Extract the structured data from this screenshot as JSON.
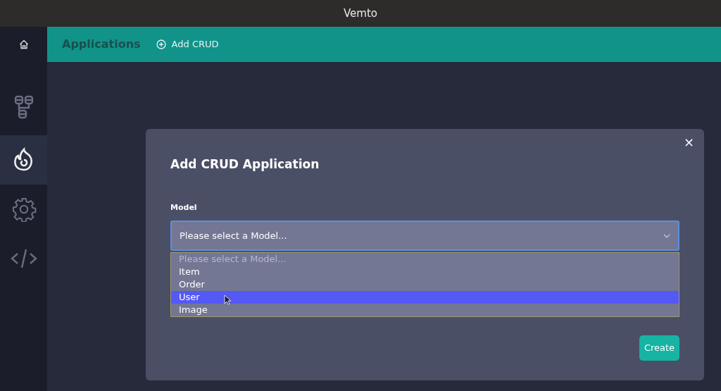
{
  "window": {
    "title": "Vemto"
  },
  "sidebar": {
    "items": [
      {
        "kind": "home",
        "selected": false
      },
      {
        "kind": "diagram",
        "selected": false
      },
      {
        "kind": "flame",
        "selected": true
      },
      {
        "kind": "gear",
        "selected": false
      },
      {
        "kind": "code",
        "selected": false
      }
    ]
  },
  "header": {
    "title": "Applications",
    "action": "Add CRUD"
  },
  "dialog": {
    "title": "Add CRUD Application",
    "close": "×",
    "field_label": "Model",
    "select_value": "Please select a Model...",
    "options": [
      {
        "label": "Please select a Model...",
        "kind": "placeholder",
        "selected": false
      },
      {
        "label": "Item",
        "kind": "option",
        "selected": false
      },
      {
        "label": "Order",
        "kind": "option",
        "selected": false
      },
      {
        "label": "User",
        "kind": "option",
        "selected": true
      },
      {
        "label": "Image",
        "kind": "option",
        "selected": false
      }
    ],
    "button": "Create"
  }
}
